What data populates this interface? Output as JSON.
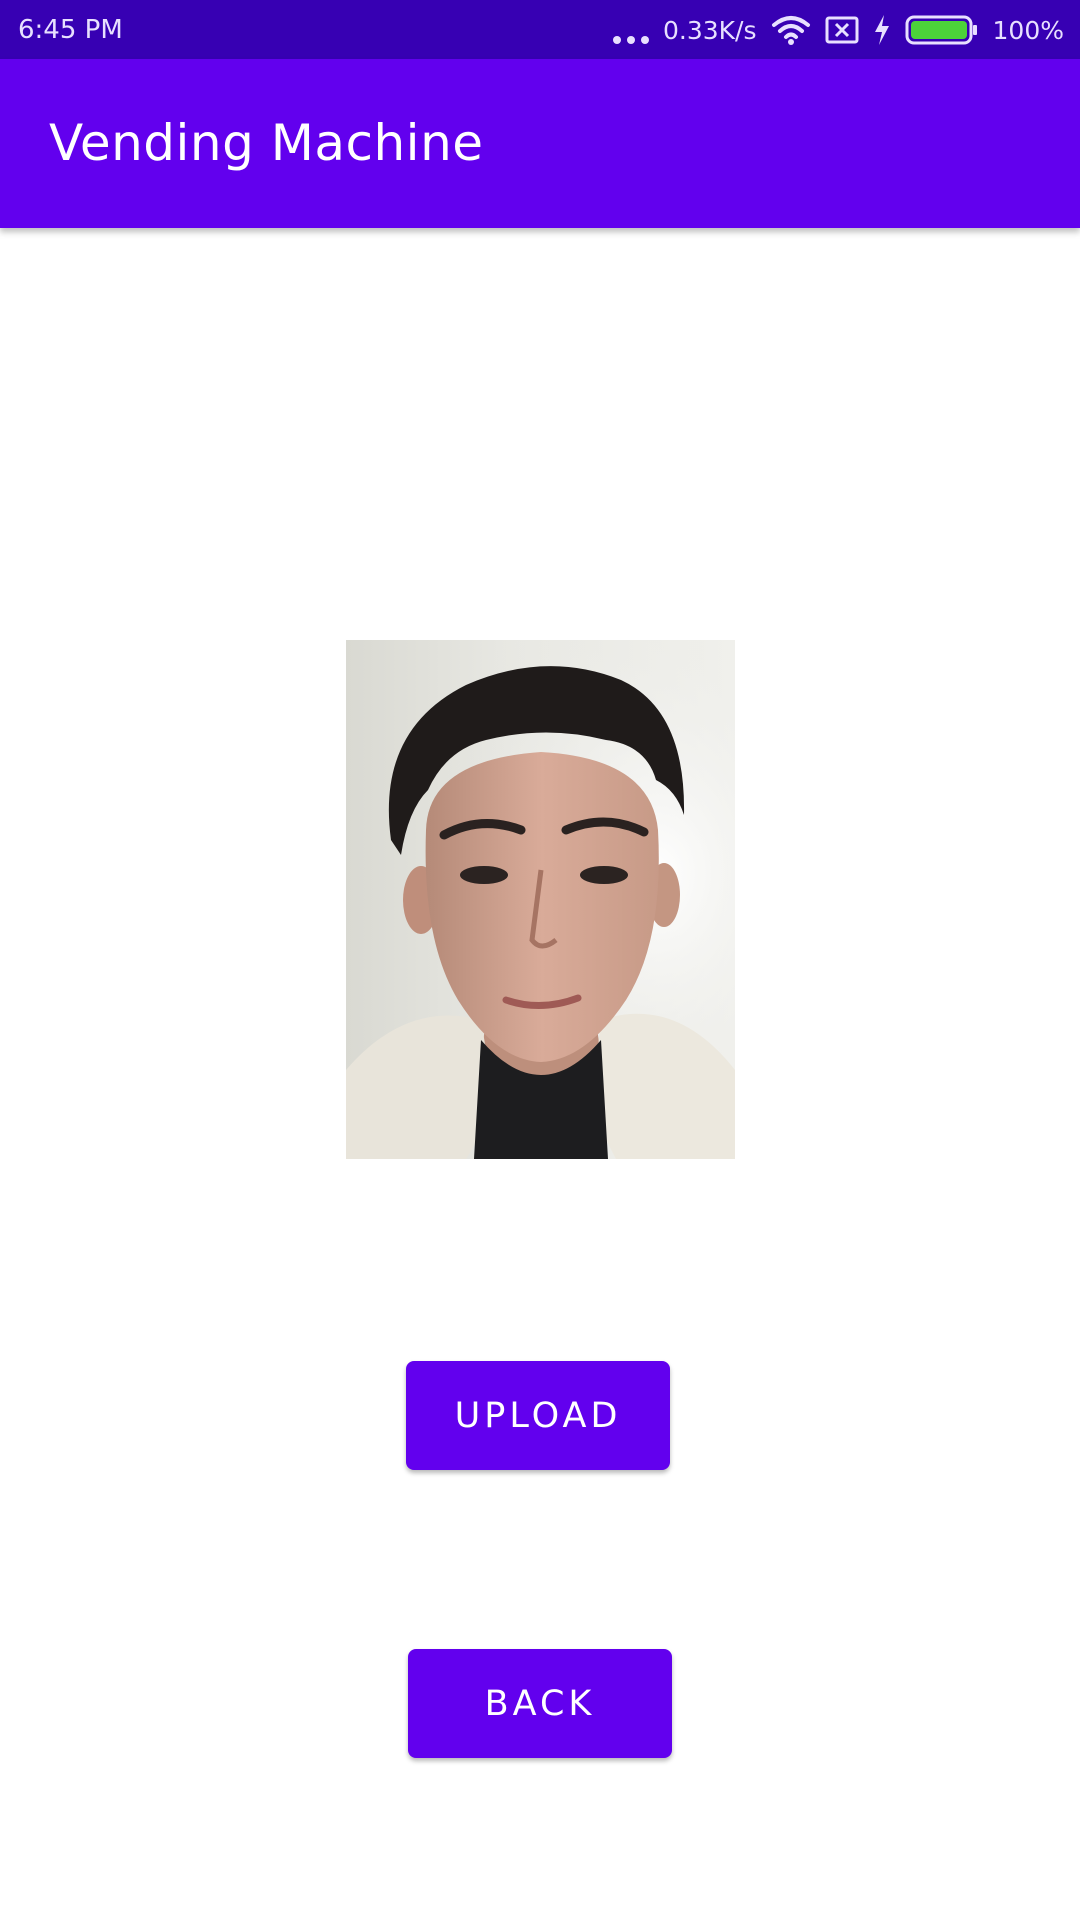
{
  "status_bar": {
    "time": "6:45 PM",
    "net_speed": "0.33K/s",
    "battery_percent": "100%",
    "battery_level": 1.0,
    "icons": [
      "more-dots-icon",
      "wifi-icon",
      "sim-blocked-icon",
      "charging-bolt-icon",
      "battery-icon"
    ]
  },
  "app_bar": {
    "title": "Vending Machine"
  },
  "main": {
    "photo_icon": "face-photo",
    "upload_label": "UPLOAD",
    "back_label": "BACK"
  },
  "colors": {
    "status_bar": "#3700b3",
    "primary": "#6200ee",
    "battery_fill": "#4cd33a",
    "background": "#ffffff"
  }
}
